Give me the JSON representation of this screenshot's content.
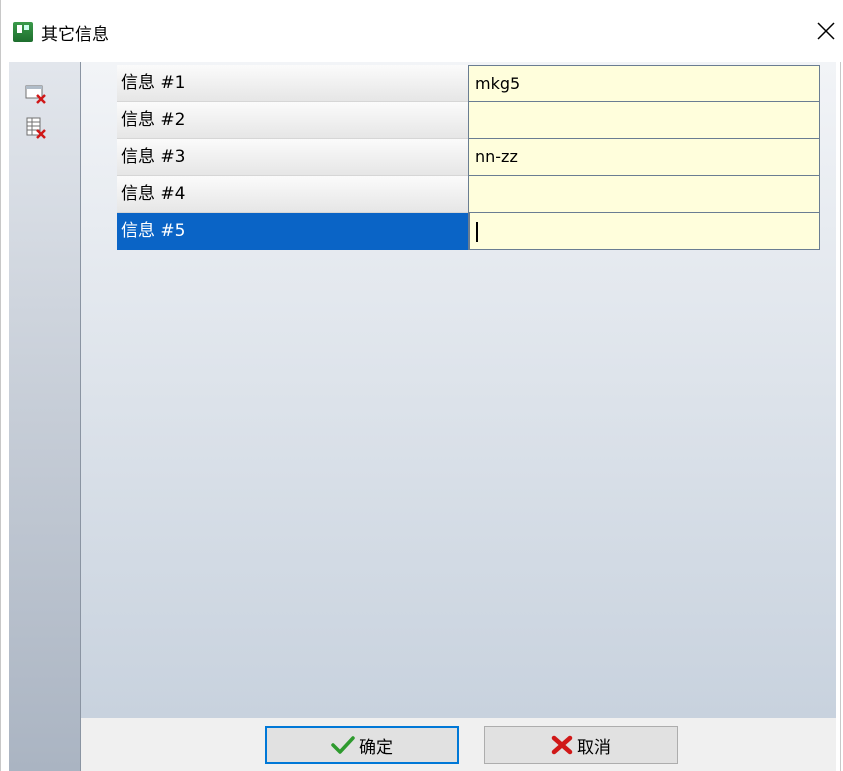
{
  "window": {
    "title": "其它信息"
  },
  "grid": {
    "rows": [
      {
        "label": "信息 #1",
        "value": "mkg5"
      },
      {
        "label": "信息 #2",
        "value": ""
      },
      {
        "label": "信息 #3",
        "value": "nn-zz"
      },
      {
        "label": "信息 #4",
        "value": ""
      },
      {
        "label": "信息 #5",
        "value": ""
      }
    ],
    "selected_row": 5
  },
  "toolbar": {
    "tools": [
      {
        "icon": "delete-field-icon"
      },
      {
        "icon": "delete-table-icon"
      }
    ]
  },
  "buttons": {
    "ok_label": "确定",
    "cancel_label": "取消"
  },
  "colors": {
    "selection": "#0a64c6",
    "value_bg": "#fffedc",
    "ok_border": "#0078d7"
  }
}
